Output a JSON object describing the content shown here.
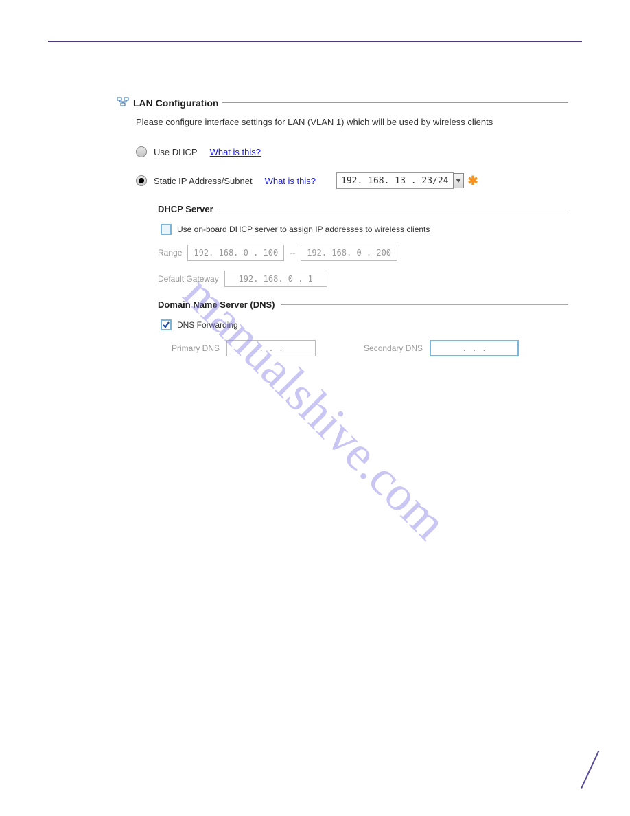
{
  "section": {
    "title": "LAN Configuration",
    "intro": "Please configure interface settings for LAN (VLAN 1) which will be used by wireless clients"
  },
  "dhcp_option": {
    "label": "Use DHCP",
    "help": "What is this?",
    "selected": false
  },
  "static_option": {
    "label": "Static IP Address/Subnet",
    "help": "What is this?",
    "selected": true,
    "ip": "192. 168.  13 .  23",
    "slash": " / ",
    "subnet": "24"
  },
  "dhcp_server": {
    "title": "DHCP Server",
    "checkbox_label": "Use on-board DHCP server to assign IP addresses to wireless clients",
    "checked": false,
    "range_label": "Range",
    "range_from": "192. 168.  0 . 100",
    "range_to": "192. 168.  0 . 200",
    "gateway_label": "Default Gateway",
    "gateway": "192. 168.  0 .  1"
  },
  "dns": {
    "title": "Domain Name Server (DNS)",
    "forwarding_label": "DNS Forwarding",
    "forwarding_checked": true,
    "primary_label": "Primary DNS",
    "primary_value": ".    .    .",
    "secondary_label": "Secondary DNS",
    "secondary_value": ".    .    ."
  },
  "watermark": "manualshive.com"
}
